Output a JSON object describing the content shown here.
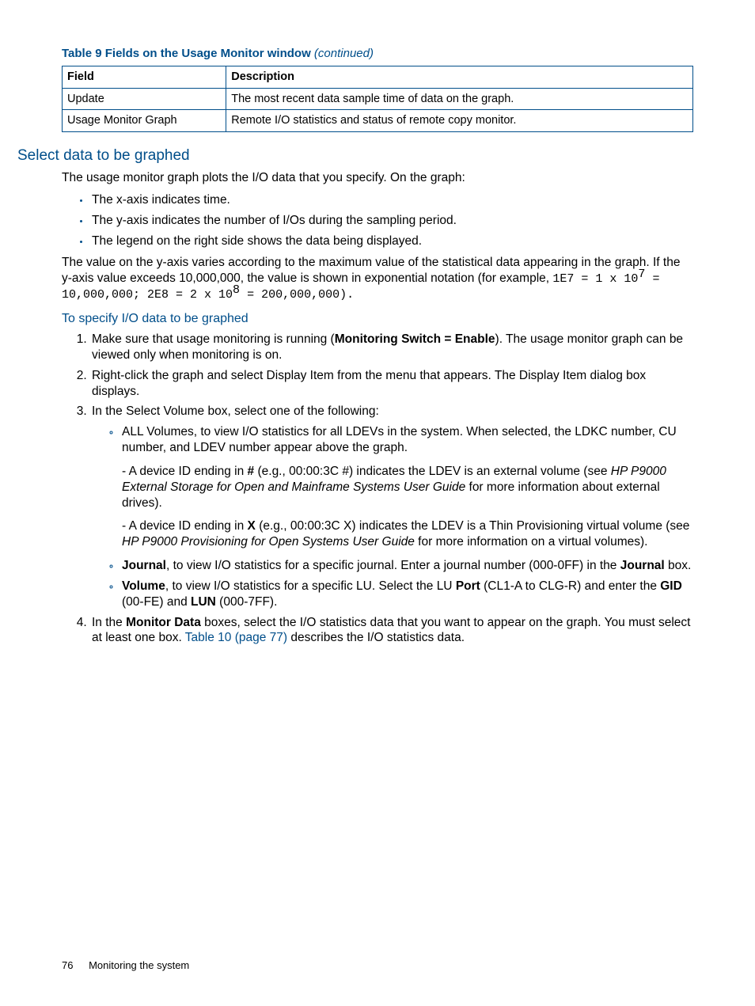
{
  "table": {
    "caption_main": "Table 9 Fields on the Usage Monitor window",
    "caption_cont": "(continued)",
    "headers": {
      "field": "Field",
      "desc": "Description"
    },
    "rows": [
      {
        "field": "Update",
        "desc": "The most recent data sample time of data on the graph."
      },
      {
        "field": "Usage Monitor Graph",
        "desc": "Remote I/O statistics and status of remote copy monitor."
      }
    ]
  },
  "section_title": "Select data to be graphed",
  "intro": "The usage monitor graph plots the I/O data that you specify. On the graph:",
  "axes": [
    "The x-axis indicates time.",
    "The y-axis indicates the number of I/Os during the sampling period.",
    "The legend on the right side shows the data being displayed."
  ],
  "yaxis_para_a": "The value on the y-axis varies according to the maximum value of the statistical data appearing in the graph. If the y-axis value exceeds 10,000,000, the value is shown in exponential notation (for example, ",
  "yaxis_code_a": "1E7 = 1 x 10",
  "yaxis_sup_a": "7",
  "yaxis_code_b": " = 10,000,000; 2E8 = 2 x 10",
  "yaxis_sup_b": "8",
  "yaxis_code_c": " = 200,000,000).",
  "subhead": "To specify I/O data to be graphed",
  "steps": {
    "s1_a": "Make sure that usage monitoring is running (",
    "s1_bold": "Monitoring Switch = Enable",
    "s1_b": "). The usage monitor graph can be viewed only when monitoring is on.",
    "s2": "Right-click the graph and select Display Item from the menu that appears. The Display Item dialog box displays.",
    "s3": "In the Select Volume box, select one of the following:",
    "s3_items": {
      "all_a": "ALL Volumes, to view I/O statistics for all LDEVs in the system. When selected, the LDKC number, CU number, and LDEV number appear above the graph.",
      "all_note1_a": "- A device ID ending in ",
      "all_note1_bold": "#",
      "all_note1_b": " (e.g., 00:00:3C #) indicates the LDEV is an external volume (see ",
      "all_note1_ital": "HP P9000 External Storage for Open and Mainframe Systems User Guide",
      "all_note1_c": " for more information about external drives).",
      "all_note2_a": "- A device ID ending in ",
      "all_note2_bold": "X",
      "all_note2_b": " (e.g., 00:00:3C X) indicates the LDEV is a Thin Provisioning virtual volume (see ",
      "all_note2_ital": "HP P9000 Provisioning for Open Systems User Guide",
      "all_note2_c": " for more information on a virtual volumes).",
      "journal_bold": "Journal",
      "journal_a": ", to view I/O statistics for a specific journal. Enter a journal number (000-0FF) in the ",
      "journal_bold2": "Journal",
      "journal_b": " box.",
      "vol_bold": "Volume",
      "vol_a": ", to view I/O statistics for a specific LU. Select the LU ",
      "vol_bold2": "Port",
      "vol_b": " (CL1-A to CLG-R) and enter the ",
      "vol_bold3": "GID",
      "vol_c": " (00-FE) and ",
      "vol_bold4": "LUN",
      "vol_d": " (000-7FF)."
    },
    "s4_a": "In the ",
    "s4_bold": "Monitor Data",
    "s4_b": " boxes, select the I/O statistics data that you want to appear on the graph. You must select at least one box. ",
    "s4_link": "Table 10 (page 77)",
    "s4_c": " describes the I/O statistics data."
  },
  "footer": {
    "page": "76",
    "title": "Monitoring the system"
  }
}
